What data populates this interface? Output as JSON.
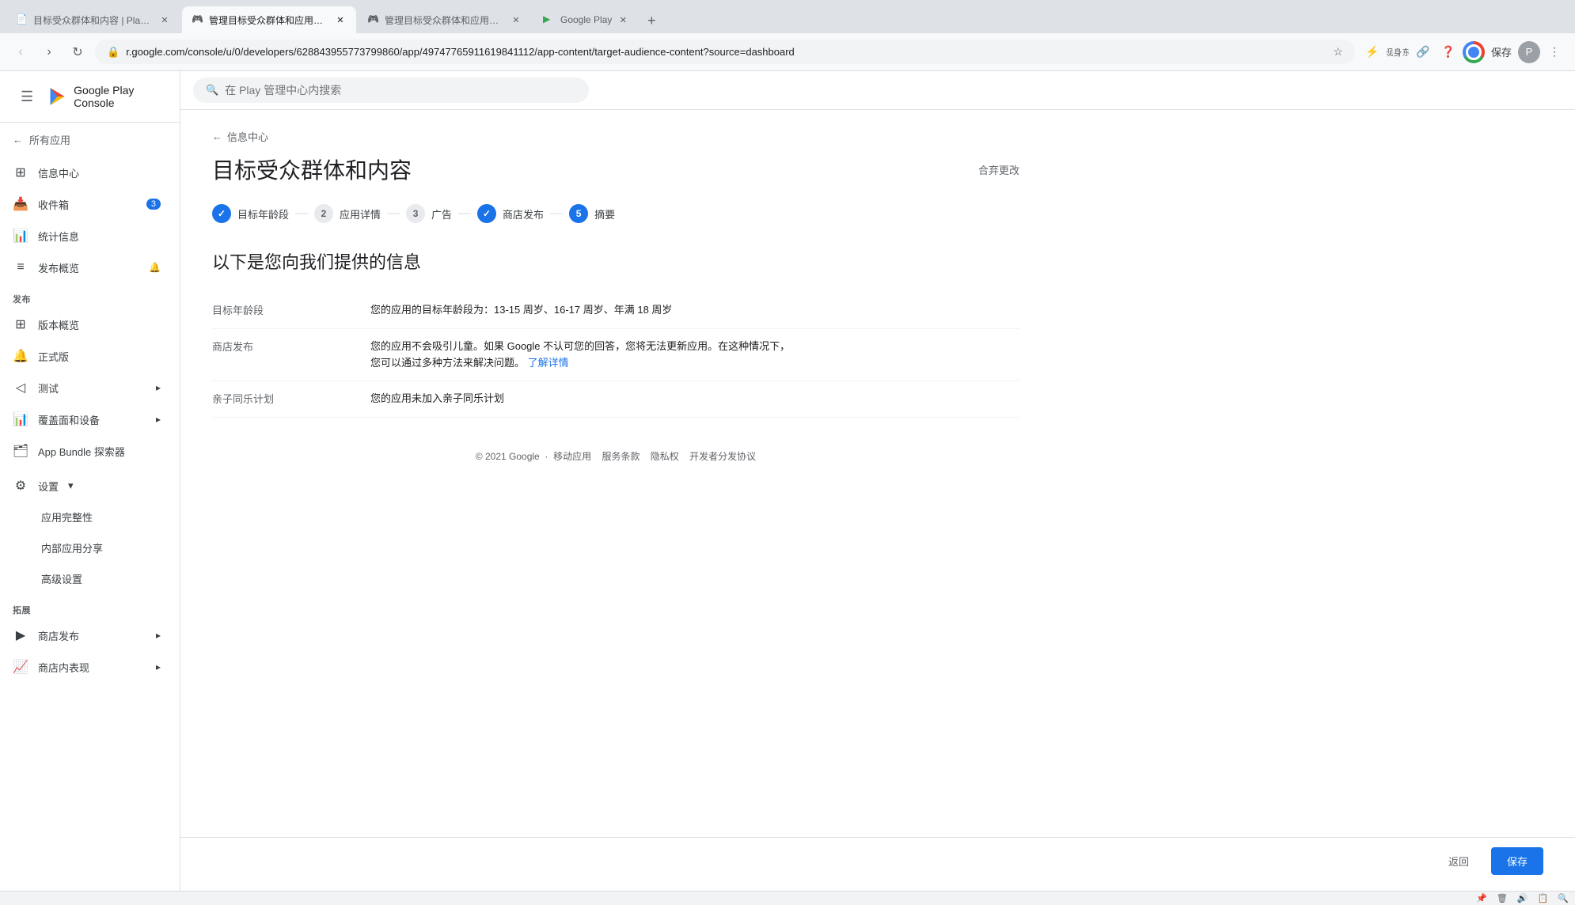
{
  "browser": {
    "tabs": [
      {
        "id": "tab1",
        "title": "目标受众群体和内容 | Plam Ba...",
        "active": false,
        "favicon": "📄"
      },
      {
        "id": "tab2",
        "title": "管理目标受众群体和应用内容…",
        "active": true,
        "favicon": "🎮"
      },
      {
        "id": "tab3",
        "title": "管理目标受众群体和应用内容…",
        "active": false,
        "favicon": "🎮"
      },
      {
        "id": "tab4",
        "title": "Google Play",
        "active": false,
        "favicon": "▶"
      }
    ],
    "url": "r.google.com/console/u/0/developers/628843955773799860/app/49747765911619841112/app-content/target-audience-content?source=dashboard",
    "search_placeholder": "在 Play 管理中心内搜索",
    "bookmark_text": "京牌车现身东京街头"
  },
  "sidebar": {
    "logo_text": "Google Play Console",
    "back_label": "所有应用",
    "items": [
      {
        "id": "info-center",
        "icon": "⊞",
        "label": "信息中心",
        "active": false,
        "badge": null
      },
      {
        "id": "inbox",
        "icon": "📥",
        "label": "收件箱",
        "active": false,
        "badge": "3"
      },
      {
        "id": "stats",
        "icon": "📊",
        "label": "统计信息",
        "active": false,
        "badge": null
      },
      {
        "id": "publish-overview",
        "icon": "≡",
        "label": "发布概览",
        "active": false,
        "badge": null,
        "has_icon2": true
      }
    ],
    "sections": [
      {
        "label": "发布",
        "items": [
          {
            "id": "version-overview",
            "icon": "⊞",
            "label": "版本概览",
            "active": false
          },
          {
            "id": "release",
            "icon": "🔔",
            "label": "正式版",
            "active": false
          },
          {
            "id": "test",
            "icon": "◁",
            "label": "测试",
            "active": false,
            "has_arrow": true
          },
          {
            "id": "coverage",
            "icon": "📊",
            "label": "覆盖面和设备",
            "active": false,
            "has_arrow": true
          },
          {
            "id": "appbundle",
            "icon": "🗂",
            "label": "App Bundle 探索器",
            "active": false
          }
        ]
      },
      {
        "label": "",
        "items": [
          {
            "id": "settings",
            "icon": "⚙",
            "label": "设置",
            "active": false,
            "has_arrow": true,
            "expanded": true
          },
          {
            "id": "app-integrity",
            "icon": "",
            "label": "应用完整性",
            "active": false,
            "sub": true
          },
          {
            "id": "internal-share",
            "icon": "",
            "label": "内部应用分享",
            "active": false,
            "sub": true
          },
          {
            "id": "advanced",
            "icon": "",
            "label": "高级设置",
            "active": false,
            "sub": true
          }
        ]
      }
    ],
    "expand_sections": [
      {
        "label": "拓展",
        "items": [
          {
            "id": "store-publish",
            "icon": "▶",
            "label": "商店发布",
            "has_arrow": true
          },
          {
            "id": "store-performance",
            "icon": "📈",
            "label": "商店内表现",
            "has_arrow": true
          }
        ]
      }
    ]
  },
  "page": {
    "breadcrumb": "信息中心",
    "title": "目标受众群体和内容",
    "discard_label": "合弃更改",
    "steps": [
      {
        "id": "target-age",
        "number": "✓",
        "label": "目标年龄段",
        "state": "done"
      },
      {
        "id": "app-details",
        "number": "2",
        "label": "应用详情",
        "state": "inactive"
      },
      {
        "id": "ads",
        "number": "3",
        "label": "广告",
        "state": "inactive"
      },
      {
        "id": "store-publish",
        "number": "✓",
        "label": "商店发布",
        "state": "done"
      },
      {
        "id": "summary",
        "number": "5",
        "label": "摘要",
        "state": "active"
      }
    ],
    "section_title": "以下是您向我们提供的信息",
    "info_rows": [
      {
        "label": "目标年龄段",
        "value": "您的应用的目标年龄段为：13-15 周岁、16-17 周岁、年满 18 周岁",
        "has_link": false
      },
      {
        "label": "商店发布",
        "value": "您的应用不会吸引儿童。如果 Google 不认可您的回答，您将无法更新应用。在这种情况下，\n您可以通过多种方法来解决问题。",
        "link_text": "了解详情",
        "link_url": "#",
        "has_link": true
      },
      {
        "label": "亲子同乐计划",
        "value": "您的应用未加入亲子同乐计划",
        "has_link": false
      }
    ],
    "footer": {
      "copyright": "© 2021 Google",
      "links": [
        "移动应用",
        "服务条款",
        "隐私权",
        "开发者分发协议"
      ]
    },
    "actions": {
      "back_label": "返回",
      "save_label": "保存"
    }
  }
}
